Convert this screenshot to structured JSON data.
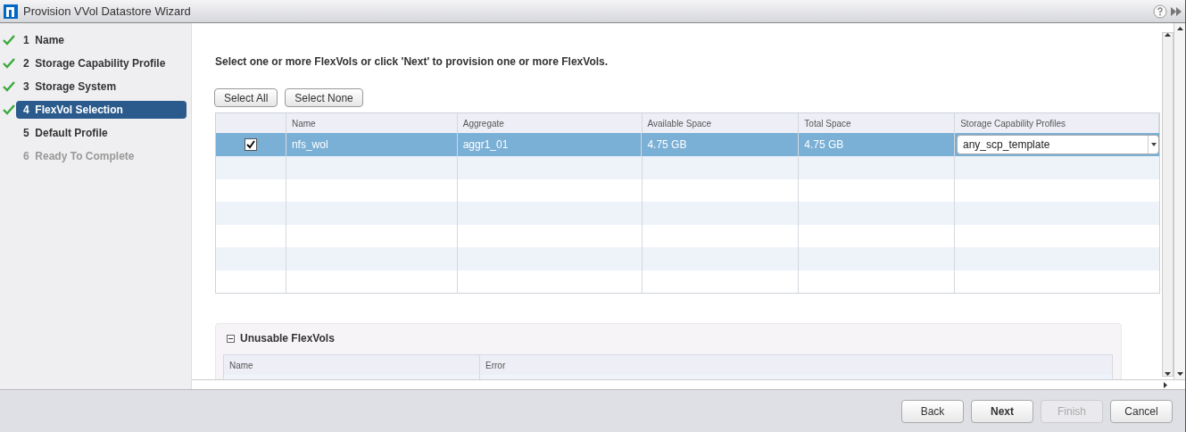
{
  "window": {
    "title": "Provision VVol Datastore Wizard"
  },
  "steps": [
    {
      "label": "1  Name",
      "completed": true,
      "selected": false,
      "disabled": false
    },
    {
      "label": "2  Storage Capability Profile",
      "completed": true,
      "selected": false,
      "disabled": false
    },
    {
      "label": "3  Storage System",
      "completed": true,
      "selected": false,
      "disabled": false
    },
    {
      "label": "4  FlexVol Selection",
      "completed": true,
      "selected": true,
      "disabled": false
    },
    {
      "label": "5  Default Profile",
      "completed": false,
      "selected": false,
      "disabled": false
    },
    {
      "label": "6  Ready To Complete",
      "completed": false,
      "selected": false,
      "disabled": true
    }
  ],
  "instruction": "Select one or more FlexVols or click 'Next' to provision one or more FlexVols.",
  "selection_buttons": [
    "Select All",
    "Select None"
  ],
  "table": {
    "columns": [
      "Name",
      "Aggregate",
      "Available Space",
      "Total Space",
      "Storage Capability Profiles"
    ],
    "rows": [
      {
        "checked": true,
        "selected": true,
        "name": "nfs_wol",
        "aggregate": "aggr1_01",
        "available_space": "4.75 GB",
        "total_space": "4.75 GB",
        "profile": "any_scp_template"
      }
    ]
  },
  "unusable": {
    "title": "Unusable FlexVols",
    "expanded": true,
    "columns": [
      "Name",
      "Error"
    ]
  },
  "footer_buttons": [
    {
      "label": "Back",
      "default": false,
      "disabled": false
    },
    {
      "label": "Next",
      "default": true,
      "disabled": false
    },
    {
      "label": "Finish",
      "default": false,
      "disabled": true
    },
    {
      "label": "Cancel",
      "default": false,
      "disabled": false
    }
  ]
}
